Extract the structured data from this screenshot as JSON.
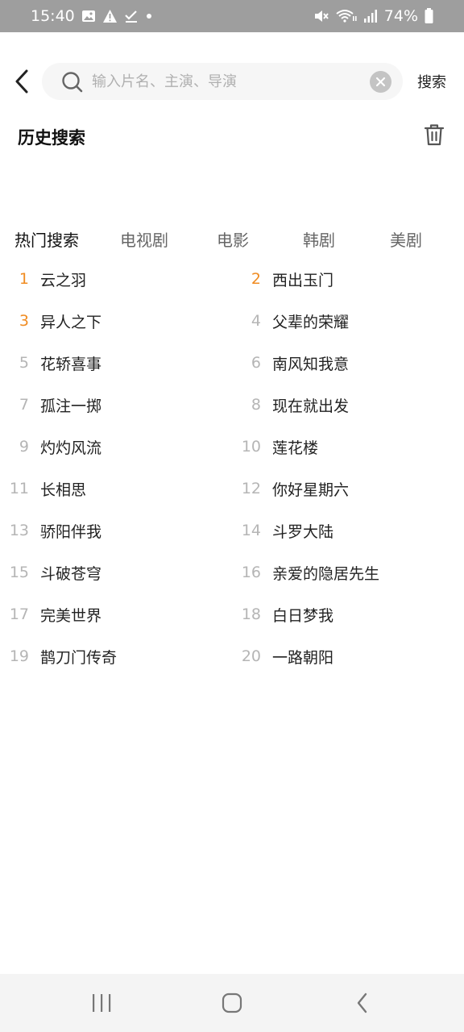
{
  "status_bar": {
    "time": "15:40",
    "battery": "74%"
  },
  "search": {
    "placeholder": "输入片名、主演、导演",
    "button_label": "搜索"
  },
  "history": {
    "title": "历史搜索"
  },
  "tabs": [
    {
      "label": "热门搜索",
      "active": true
    },
    {
      "label": "电视剧",
      "active": false
    },
    {
      "label": "电影",
      "active": false
    },
    {
      "label": "韩剧",
      "active": false
    },
    {
      "label": "美剧",
      "active": false
    }
  ],
  "hot_list": [
    {
      "rank": "1",
      "title": "云之羽"
    },
    {
      "rank": "2",
      "title": "西出玉门"
    },
    {
      "rank": "3",
      "title": "异人之下"
    },
    {
      "rank": "4",
      "title": "父辈的荣耀"
    },
    {
      "rank": "5",
      "title": "花轿喜事"
    },
    {
      "rank": "6",
      "title": "南风知我意"
    },
    {
      "rank": "7",
      "title": "孤注一掷"
    },
    {
      "rank": "8",
      "title": "现在就出发"
    },
    {
      "rank": "9",
      "title": "灼灼风流"
    },
    {
      "rank": "10",
      "title": "莲花楼"
    },
    {
      "rank": "11",
      "title": "长相思"
    },
    {
      "rank": "12",
      "title": "你好星期六"
    },
    {
      "rank": "13",
      "title": "骄阳伴我"
    },
    {
      "rank": "14",
      "title": "斗罗大陆"
    },
    {
      "rank": "15",
      "title": "斗破苍穹"
    },
    {
      "rank": "16",
      "title": "亲爱的隐居先生"
    },
    {
      "rank": "17",
      "title": "完美世界"
    },
    {
      "rank": "18",
      "title": "白日梦我"
    },
    {
      "rank": "19",
      "title": "鹊刀门传奇"
    },
    {
      "rank": "20",
      "title": "一路朝阳"
    }
  ],
  "colors": {
    "accent_rank": "#f08c22",
    "muted_rank": "#b5b5b5"
  }
}
